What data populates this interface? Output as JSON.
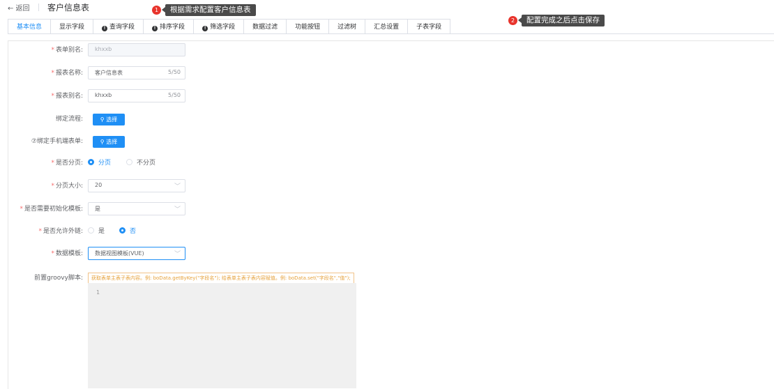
{
  "header": {
    "back_label": "← 返回",
    "title": "客户信息表"
  },
  "callouts": [
    {
      "num": "1",
      "text": "根据需求配置客户信息表"
    },
    {
      "num": "2",
      "text": "配置完成之后点击保存"
    }
  ],
  "tabs": [
    {
      "label": "基本信息",
      "active": true,
      "info": false
    },
    {
      "label": "显示字段",
      "active": false,
      "info": false
    },
    {
      "label": "查询字段",
      "active": false,
      "info": true
    },
    {
      "label": "排序字段",
      "active": false,
      "info": true
    },
    {
      "label": "筛选字段",
      "active": false,
      "info": true
    },
    {
      "label": "数据过滤",
      "active": false,
      "info": false
    },
    {
      "label": "功能按钮",
      "active": false,
      "info": false
    },
    {
      "label": "过滤树",
      "active": false,
      "info": false
    },
    {
      "label": "汇总设置",
      "active": false,
      "info": false
    },
    {
      "label": "子表字段",
      "active": false,
      "info": false
    }
  ],
  "form": {
    "form_alias": {
      "label": "表单别名:",
      "value": "khxxb"
    },
    "report_name": {
      "label": "报表名称:",
      "value": "客户信息表",
      "count": "5/50"
    },
    "report_alias": {
      "label": "报表别名:",
      "value": "khxxb",
      "count": "5/50"
    },
    "bind_flow": {
      "label": "绑定流程:",
      "button": "选择"
    },
    "bind_mobile": {
      "label": "⑦绑定手机端表单:",
      "button": "选择"
    },
    "paging": {
      "label": "是否分页:",
      "opt_yes": "分页",
      "opt_no": "不分页",
      "selected": "yes"
    },
    "page_size": {
      "label": "分页大小:",
      "value": "20"
    },
    "init_template": {
      "label": "是否需要初始化模板:",
      "value": "是"
    },
    "allow_external": {
      "label": "是否允许外链:",
      "opt_yes": "是",
      "opt_no": "否",
      "selected": "no"
    },
    "data_template": {
      "label": "数据模板:",
      "value": "数据视图模板(VUE)"
    },
    "groovy": {
      "label": "前置groovy脚本:",
      "hint": "获取表单主表子表内容。例: boData.getByKey(\"字段名\"); 给表单主表子表内容赋值。例: boData.set(\"字段名\",\"值\");",
      "line_no": "1"
    }
  }
}
